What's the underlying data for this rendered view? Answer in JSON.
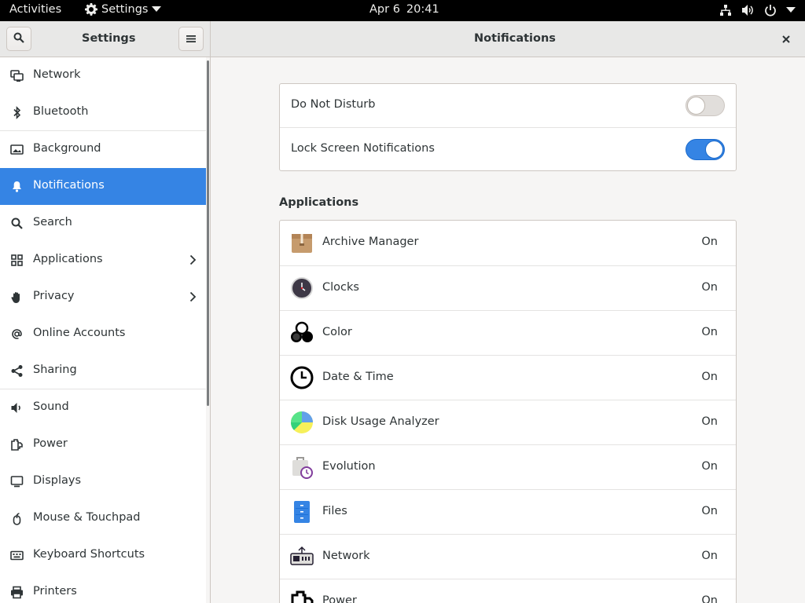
{
  "topbar": {
    "activities": "Activities",
    "app_name": "Settings",
    "date": "Apr 6",
    "time": "20:41"
  },
  "headerbar": {
    "sidebar_title": "Settings",
    "page_title": "Notifications"
  },
  "sidebar": {
    "items": [
      {
        "label": "Network",
        "icon": "network-icon"
      },
      {
        "label": "Bluetooth",
        "icon": "bluetooth-icon"
      },
      {
        "label": "Background",
        "icon": "background-icon"
      },
      {
        "label": "Notifications",
        "icon": "bell-icon",
        "active": true
      },
      {
        "label": "Search",
        "icon": "search-icon"
      },
      {
        "label": "Applications",
        "icon": "apps-grid-icon",
        "has_submenu": true
      },
      {
        "label": "Privacy",
        "icon": "hand-icon",
        "has_submenu": true
      },
      {
        "label": "Online Accounts",
        "icon": "at-icon"
      },
      {
        "label": "Sharing",
        "icon": "share-icon"
      },
      {
        "label": "Sound",
        "icon": "speaker-icon"
      },
      {
        "label": "Power",
        "icon": "power-plug-icon"
      },
      {
        "label": "Displays",
        "icon": "display-icon"
      },
      {
        "label": "Mouse & Touchpad",
        "icon": "mouse-icon"
      },
      {
        "label": "Keyboard Shortcuts",
        "icon": "keyboard-icon"
      },
      {
        "label": "Printers",
        "icon": "printer-icon"
      }
    ]
  },
  "toggles": [
    {
      "label": "Do Not Disturb",
      "state": "off"
    },
    {
      "label": "Lock Screen Notifications",
      "state": "on"
    }
  ],
  "applications": {
    "heading": "Applications",
    "items": [
      {
        "name": "Archive Manager",
        "state": "On",
        "icon": "archive-manager-icon"
      },
      {
        "name": "Clocks",
        "state": "On",
        "icon": "clocks-icon"
      },
      {
        "name": "Color",
        "state": "On",
        "icon": "color-icon"
      },
      {
        "name": "Date & Time",
        "state": "On",
        "icon": "date-time-icon"
      },
      {
        "name": "Disk Usage Analyzer",
        "state": "On",
        "icon": "disk-usage-icon"
      },
      {
        "name": "Evolution",
        "state": "On",
        "icon": "evolution-icon"
      },
      {
        "name": "Files",
        "state": "On",
        "icon": "files-icon"
      },
      {
        "name": "Network",
        "state": "On",
        "icon": "network-app-icon"
      },
      {
        "name": "Power",
        "state": "On",
        "icon": "power-app-icon"
      }
    ]
  },
  "colors": {
    "accent": "#3584e4",
    "topbar": "#000000",
    "sidebar_bg": "#ffffff",
    "content_bg": "#f6f5f4"
  }
}
